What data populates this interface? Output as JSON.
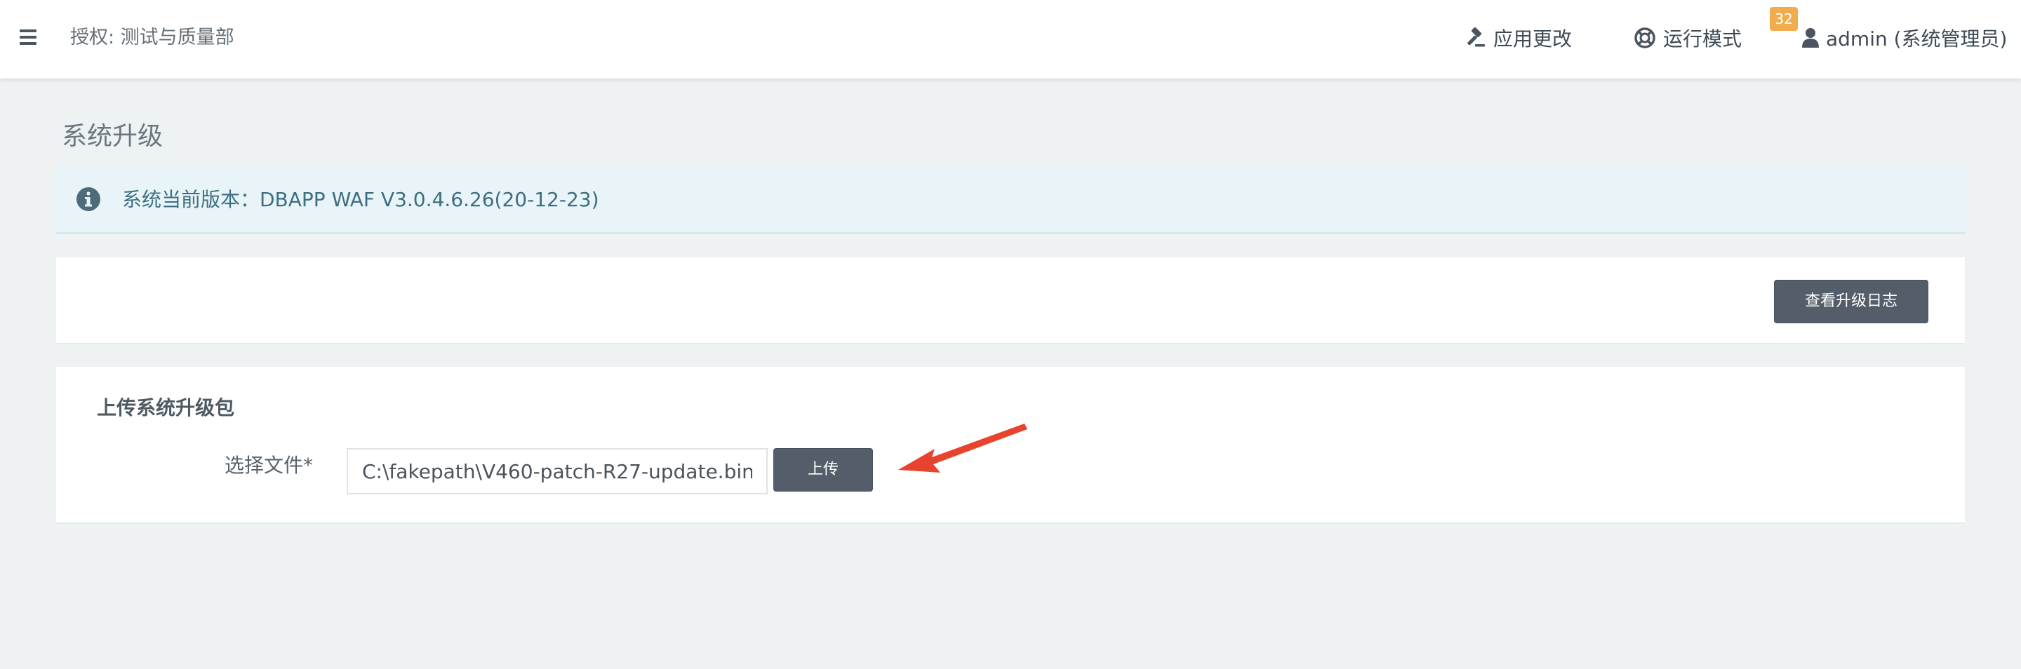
{
  "header": {
    "auth_label": "授权: 测试与质量部",
    "apply_changes_label": "应用更改",
    "run_mode_label": "运行模式",
    "notification_count": "32",
    "user_label": "admin (系统管理员)",
    "badge_color": "#f0ad4e"
  },
  "page": {
    "title": "系统升级",
    "info": {
      "text": "系统当前版本：DBAPP WAF V3.0.4.6.26(20-12-23)",
      "icon": "info-circle-icon"
    },
    "log_panel": {
      "view_log_button": "查看升级日志"
    },
    "upload_panel": {
      "section_title": "上传系统升级包",
      "file_label": "选择文件*",
      "file_value": "C:\\fakepath\\V460-patch-R27-update.bin",
      "upload_button": "上传"
    }
  },
  "annotation": {
    "arrow_color": "#e8432e"
  }
}
